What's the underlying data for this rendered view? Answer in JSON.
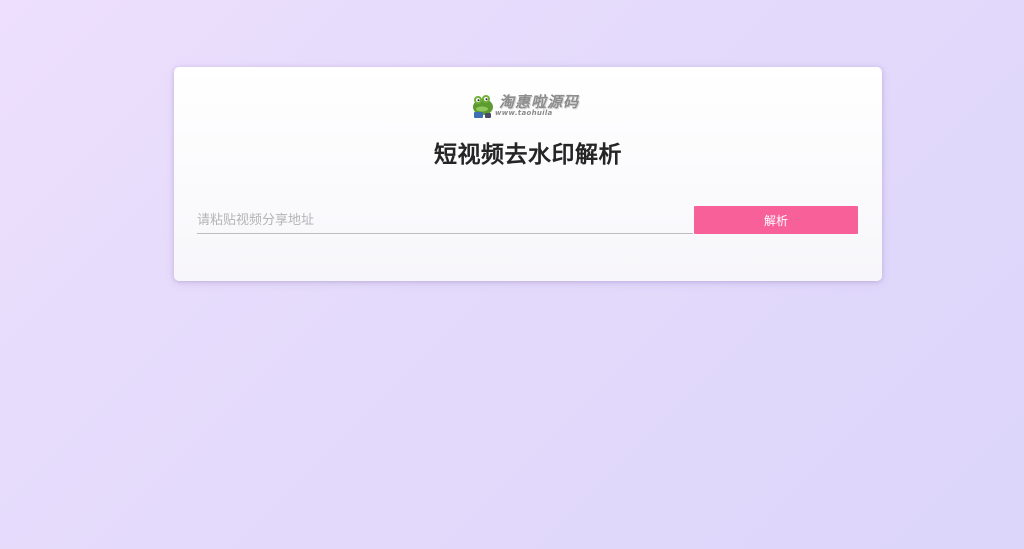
{
  "logo": {
    "name": "淘惠啦源码",
    "url": "www.taohuila"
  },
  "page_title": "短视频去水印解析",
  "input": {
    "value": "",
    "placeholder": "请粘贴视频分享地址"
  },
  "parse_button_label": "解析",
  "colors": {
    "accent": "#f8609a",
    "background_start": "#eddffd",
    "background_end": "#dcd6fb"
  }
}
